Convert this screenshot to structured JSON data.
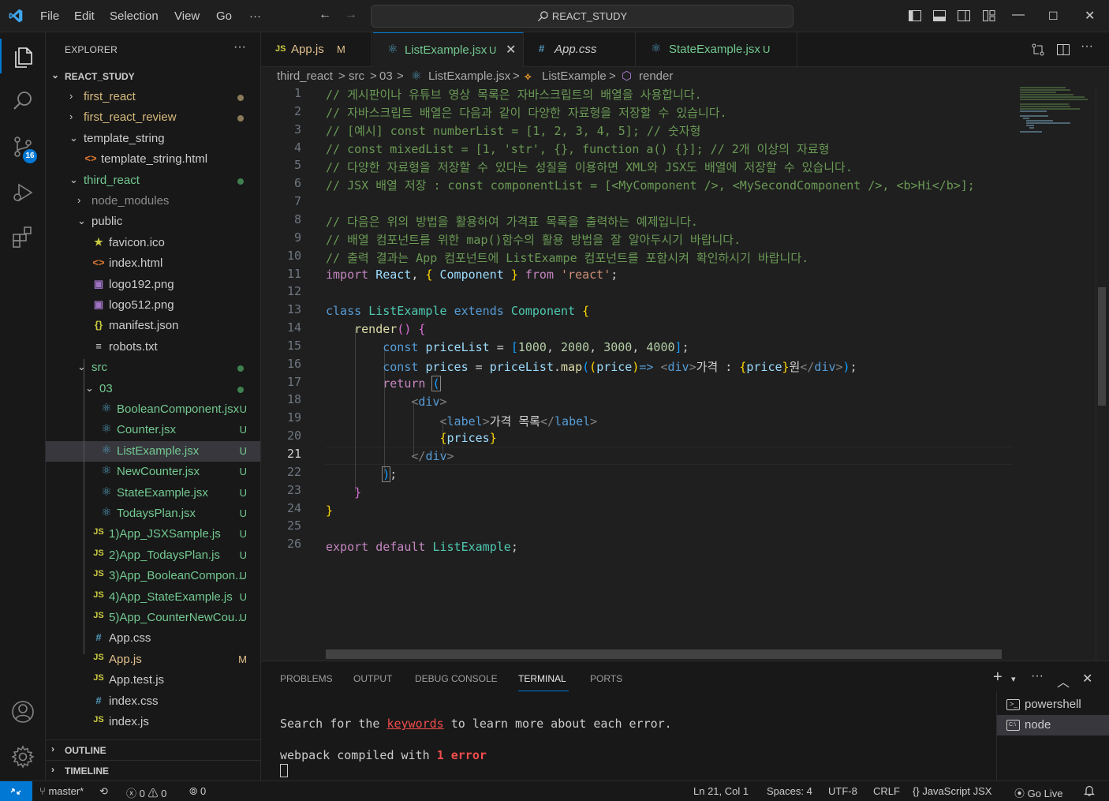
{
  "titlebar": {
    "menu": [
      "File",
      "Edit",
      "Selection",
      "View",
      "Go",
      "···"
    ],
    "search": "REACT_STUDY"
  },
  "activity": {
    "scm_badge": "16"
  },
  "sidebar": {
    "title": "EXPLORER",
    "more": "···",
    "root": "REACT_STUDY",
    "tree": [
      {
        "name": "first_react",
        "kind": "folder-closed",
        "depth": 1,
        "color": "#d7ba7d",
        "dot": "#8a7a5a"
      },
      {
        "name": "first_react_review",
        "kind": "folder-closed",
        "depth": 1,
        "color": "#d7ba7d",
        "dot": "#8a7a5a"
      },
      {
        "name": "template_string",
        "kind": "folder-open",
        "depth": 1,
        "color": "#cccccc"
      },
      {
        "name": "template_string.html",
        "kind": "html",
        "depth": 2,
        "color": "#cccccc"
      },
      {
        "name": "third_react",
        "kind": "folder-open",
        "depth": 1,
        "color": "#73c991",
        "dot": "#3f7f50"
      },
      {
        "name": "node_modules",
        "kind": "folder-closed",
        "depth": 2,
        "color": "#8c8c8c"
      },
      {
        "name": "public",
        "kind": "folder-open",
        "depth": 2,
        "color": "#cccccc"
      },
      {
        "name": "favicon.ico",
        "kind": "star",
        "depth": 3,
        "color": "#cccccc"
      },
      {
        "name": "index.html",
        "kind": "html",
        "depth": 3,
        "color": "#cccccc"
      },
      {
        "name": "logo192.png",
        "kind": "image",
        "depth": 3,
        "color": "#cccccc"
      },
      {
        "name": "logo512.png",
        "kind": "image",
        "depth": 3,
        "color": "#cccccc"
      },
      {
        "name": "manifest.json",
        "kind": "json",
        "depth": 3,
        "color": "#cccccc"
      },
      {
        "name": "robots.txt",
        "kind": "txt",
        "depth": 3,
        "color": "#cccccc"
      },
      {
        "name": "src",
        "kind": "folder-open",
        "depth": 2,
        "color": "#73c991",
        "dot": "#3f7f50"
      },
      {
        "name": "03",
        "kind": "folder-open",
        "depth": 3,
        "color": "#73c991",
        "dot": "#3f7f50"
      },
      {
        "name": "BooleanComponent.jsx",
        "kind": "react",
        "depth": 4,
        "color": "#73c991",
        "status": "U"
      },
      {
        "name": "Counter.jsx",
        "kind": "react",
        "depth": 4,
        "color": "#73c991",
        "status": "U"
      },
      {
        "name": "ListExample.jsx",
        "kind": "react",
        "depth": 4,
        "color": "#73c991",
        "status": "U",
        "selected": true
      },
      {
        "name": "NewCounter.jsx",
        "kind": "react",
        "depth": 4,
        "color": "#73c991",
        "status": "U"
      },
      {
        "name": "StateExample.jsx",
        "kind": "react",
        "depth": 4,
        "color": "#73c991",
        "status": "U"
      },
      {
        "name": "TodaysPlan.jsx",
        "kind": "react",
        "depth": 4,
        "color": "#73c991",
        "status": "U"
      },
      {
        "name": "1)App_JSXSample.js",
        "kind": "js",
        "depth": 3,
        "color": "#73c991",
        "status": "U"
      },
      {
        "name": "2)App_TodaysPlan.js",
        "kind": "js",
        "depth": 3,
        "color": "#73c991",
        "status": "U"
      },
      {
        "name": "3)App_BooleanCompon...",
        "kind": "js",
        "depth": 3,
        "color": "#73c991",
        "status": "U"
      },
      {
        "name": "4)App_StateExample.js",
        "kind": "js",
        "depth": 3,
        "color": "#73c991",
        "status": "U"
      },
      {
        "name": "5)App_CounterNewCou...",
        "kind": "js",
        "depth": 3,
        "color": "#73c991",
        "status": "U"
      },
      {
        "name": "App.css",
        "kind": "css",
        "depth": 3,
        "color": "#cccccc"
      },
      {
        "name": "App.js",
        "kind": "js",
        "depth": 3,
        "color": "#e2c08d",
        "status": "M"
      },
      {
        "name": "App.test.js",
        "kind": "js",
        "depth": 3,
        "color": "#cccccc"
      },
      {
        "name": "index.css",
        "kind": "css",
        "depth": 3,
        "color": "#cccccc"
      },
      {
        "name": "index.js",
        "kind": "js",
        "depth": 3,
        "color": "#cccccc"
      }
    ],
    "sections": [
      "OUTLINE",
      "TIMELINE"
    ]
  },
  "tabs": [
    {
      "icon": "JS",
      "label": "App.js",
      "status": "M",
      "italic": false,
      "active": false
    },
    {
      "icon": "⚛",
      "label": "ListExample.jsx",
      "status": "U",
      "italic": false,
      "active": true
    },
    {
      "icon": "#",
      "label": "App.css",
      "status": "",
      "italic": true,
      "active": false
    },
    {
      "icon": "⚛",
      "label": "StateExample.jsx",
      "status": "U",
      "italic": false,
      "active": false
    }
  ],
  "breadcrumb": [
    "third_react",
    ">",
    "src",
    ">",
    "03",
    ">",
    "ListExample.jsx",
    ">",
    "ListExample",
    ">",
    "render"
  ],
  "editor": {
    "line_numbers": [
      "1",
      "2",
      "3",
      "4",
      "5",
      "6",
      "7",
      "8",
      "9",
      "10",
      "11",
      "12",
      "13",
      "14",
      "15",
      "16",
      "17",
      "18",
      "19",
      "20",
      "21",
      "22",
      "23",
      "24",
      "25",
      "26"
    ],
    "current_line": 21
  },
  "panel": {
    "tabs": [
      "PROBLEMS",
      "OUTPUT",
      "DEBUG CONSOLE",
      "TERMINAL",
      "PORTS"
    ],
    "active_tab": "TERMINAL",
    "terminal": {
      "line1_pre": "Search for the ",
      "line1_link": "keywords",
      "line1_post": " to learn more about each error.",
      "line2_pre": "webpack compiled with ",
      "line2_err": "1 error"
    },
    "terminals": [
      "powershell",
      "node"
    ]
  },
  "statusbar": {
    "branch": "master*",
    "errors": "0",
    "warnings": "0",
    "ports": "0",
    "position": "Ln 21, Col 1",
    "spaces": "Spaces: 4",
    "encoding": "UTF-8",
    "eol": "CRLF",
    "language": "JavaScript JSX",
    "golive": "Go Live"
  }
}
